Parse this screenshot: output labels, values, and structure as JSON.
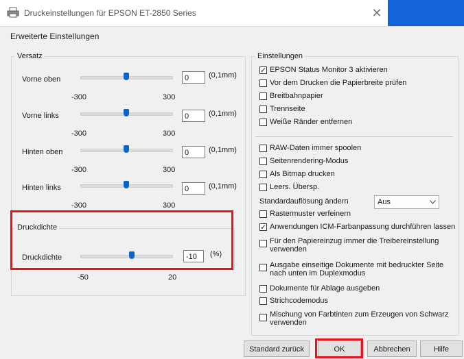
{
  "window": {
    "title": "Druckeinstellungen für EPSON ET-2850 Series",
    "close_glyph": "✕",
    "app_icon": "printer-icon"
  },
  "page": {
    "heading": "Erweiterte Einstellungen"
  },
  "offset": {
    "legend": "Versatz",
    "rows": [
      {
        "label": "Vorne oben",
        "value": "0",
        "unit": "(0,1mm)",
        "min": "-300",
        "max": "300"
      },
      {
        "label": "Vorne links",
        "value": "0",
        "unit": "(0,1mm)",
        "min": "-300",
        "max": "300"
      },
      {
        "label": "Hinten oben",
        "value": "0",
        "unit": "(0,1mm)",
        "min": "-300",
        "max": "300"
      },
      {
        "label": "Hinten links",
        "value": "0",
        "unit": "(0,1mm)",
        "min": "-300",
        "max": "300"
      }
    ]
  },
  "density": {
    "legend": "Druckdichte",
    "label": "Druckdichte",
    "value": "-10",
    "unit": "(%)",
    "min": "-50",
    "max": "20"
  },
  "settings": {
    "legend": "Einstellungen",
    "group1": [
      {
        "label": "EPSON Status Monitor 3 aktivieren",
        "checked": true
      },
      {
        "label": "Vor dem Drucken die Papierbreite prüfen",
        "checked": false
      },
      {
        "label": "Breitbahnpapier",
        "checked": false
      },
      {
        "label": "Trennseite",
        "checked": false
      },
      {
        "label": "Weiße Ränder entfernen",
        "checked": false
      }
    ],
    "group2": [
      {
        "label": "RAW-Daten immer spoolen",
        "checked": false
      },
      {
        "label": "Seitenrendering-Modus",
        "checked": false
      },
      {
        "label": "Als Bitmap drucken",
        "checked": false
      },
      {
        "label": "Leers. Übersp.",
        "checked": false
      }
    ],
    "resolution_label": "Standardauflösung ändern",
    "resolution_value": "Aus",
    "group3": [
      {
        "label": "Rastermuster verfeinern",
        "checked": false
      },
      {
        "label": "Anwendungen ICM-Farbanpassung durchführen lassen",
        "checked": true
      },
      {
        "label": "Für den Papiereinzug immer die Treibereinstellung verwenden",
        "checked": false
      },
      {
        "label": "Ausgabe einseitige Dokumente mit bedruckter Seite nach unten im Duplexmodus",
        "checked": false
      },
      {
        "label": "Dokumente für Ablage ausgeben",
        "checked": false
      },
      {
        "label": "Strichcodemodus",
        "checked": false
      },
      {
        "label": "Mischung von Farbtinten zum Erzeugen von Schwarz verwenden",
        "checked": false
      }
    ]
  },
  "buttons": {
    "reset": "Standard zurück",
    "ok": "OK",
    "cancel": "Abbrechen",
    "help": "Hilfe"
  },
  "colors": {
    "highlight_red": "#e8141c",
    "accent_blue": "#1466d8",
    "slider_thumb": "#0a64c8"
  }
}
